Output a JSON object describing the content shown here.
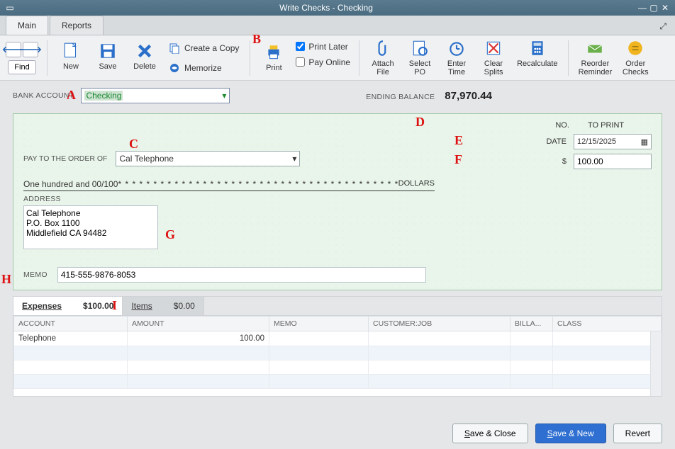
{
  "window": {
    "title": "Write Checks - Checking"
  },
  "tabs": {
    "main": "Main",
    "reports": "Reports"
  },
  "toolbar": {
    "find": "Find",
    "new": "New",
    "save": "Save",
    "delete": "Delete",
    "create_copy": "Create a Copy",
    "memorize": "Memorize",
    "print": "Print",
    "print_later": "Print Later",
    "pay_online": "Pay Online",
    "attach_file": "Attach\nFile",
    "select_po": "Select\nPO",
    "enter_time": "Enter\nTime",
    "clear_splits": "Clear\nSplits",
    "recalculate": "Recalculate",
    "reorder_reminder": "Reorder\nReminder",
    "order_checks": "Order\nChecks"
  },
  "bank": {
    "label": "BANK ACCOUNT",
    "value": "Checking",
    "ending_balance_label": "ENDING BALANCE",
    "ending_balance_value": "87,970.44"
  },
  "check": {
    "no_label": "NO.",
    "no_value": "TO PRINT",
    "date_label": "DATE",
    "date_value": "12/15/2025",
    "dollar_sign": "$",
    "amount": "100.00",
    "payto_label": "PAY TO THE ORDER OF",
    "payto_value": "Cal Telephone",
    "amount_words": "One hundred and 00/100",
    "dollars": "DOLLARS",
    "address_label": "ADDRESS",
    "address": "Cal Telephone\nP.O. Box 1100\nMiddlefield CA 94482",
    "memo_label": "MEMO",
    "memo_value": "415-555-9876-8053"
  },
  "split": {
    "expenses_label": "Expenses",
    "expenses_amount": "$100.00",
    "items_label": "Items",
    "items_amount": "$0.00",
    "columns": {
      "account": "ACCOUNT",
      "amount": "AMOUNT",
      "memo": "MEMO",
      "customer": "CUSTOMER:JOB",
      "billable": "BILLA...",
      "class": "CLASS"
    },
    "rows": [
      {
        "account": "Telephone",
        "amount": "100.00",
        "memo": "",
        "customer": "",
        "billable": "",
        "class": ""
      }
    ]
  },
  "footer": {
    "save_close": "Save & Close",
    "save_new": "Save & New",
    "revert": "Revert"
  },
  "annotations": {
    "A": "A",
    "B": "B",
    "C": "C",
    "D": "D",
    "E": "E",
    "F": "F",
    "G": "G",
    "H": "H",
    "I": "I"
  }
}
